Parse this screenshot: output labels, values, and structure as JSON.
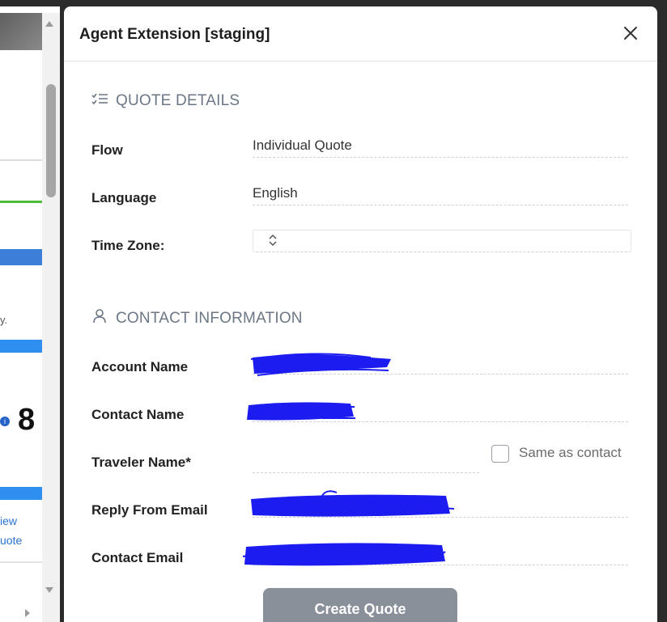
{
  "background_page": {
    "fragment_text_1": "y.",
    "big_number_fragment": "8",
    "link_fragment_1": "iew",
    "link_fragment_2": "uote"
  },
  "panel": {
    "title": "Agent Extension [staging]",
    "sections": {
      "quote_details": {
        "heading": "QUOTE DETAILS",
        "icon": "list-checks-icon",
        "fields": {
          "flow": {
            "label": "Flow",
            "value": "Individual Quote"
          },
          "language": {
            "label": "Language",
            "value": "English"
          },
          "timezone": {
            "label": "Time Zone:",
            "value": ""
          }
        }
      },
      "contact_info": {
        "heading": "CONTACT INFORMATION",
        "icon": "person-icon",
        "fields": {
          "account_name": {
            "label": "Account Name"
          },
          "contact_name": {
            "label": "Contact Name"
          },
          "traveler_name": {
            "label": "Traveler Name*",
            "value": ""
          },
          "same_as_contact": {
            "label": "Same as contact",
            "checked": false
          },
          "reply_from_email": {
            "label": "Reply From Email"
          },
          "contact_email": {
            "label": "Contact Email"
          }
        }
      }
    },
    "create_button": "Create Quote"
  },
  "colors": {
    "redaction": "#1c1cf0",
    "button": "#8a9099",
    "section_heading": "#6b7785"
  }
}
